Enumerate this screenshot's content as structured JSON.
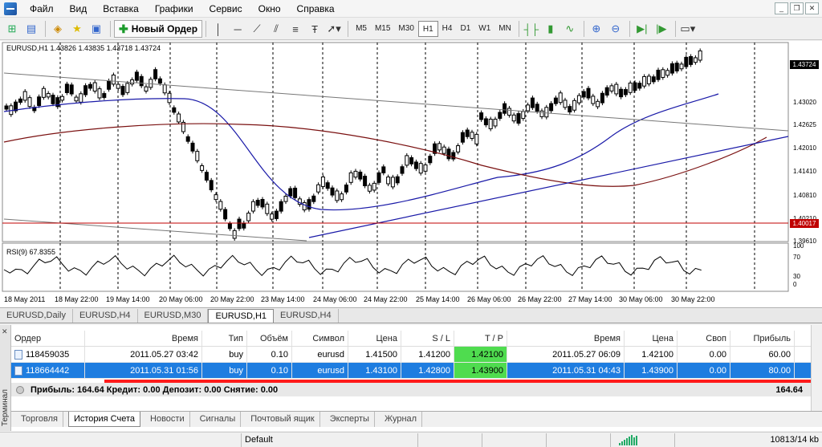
{
  "menu": [
    "Файл",
    "Вид",
    "Вставка",
    "Графики",
    "Сервис",
    "Окно",
    "Справка"
  ],
  "toolbar": {
    "new_order_label": "Новый Ордер",
    "timeframes": [
      "M5",
      "M15",
      "M30",
      "H1",
      "H4",
      "D1",
      "W1",
      "MN"
    ],
    "active_timeframe": "H1"
  },
  "chart": {
    "symbol_info": "EURUSD,H1  1.43826 1.43835 1.43718 1.43724",
    "rsi_info": "RSI(9) 67.8355",
    "current_price": "1.43724",
    "level_price": "1.40017",
    "price_labels": [
      "1.43020",
      "1.42625",
      "1.42010",
      "1.41410",
      "1.40810",
      "1.40210",
      "1.39610"
    ],
    "rsi_labels": [
      "70",
      "30",
      "0"
    ],
    "rsi_top_label": "100",
    "date_labels": [
      "18 May 2011",
      "18 May 22:00",
      "19 May 14:00",
      "20 May 06:00",
      "20 May 22:00",
      "23 May 14:00",
      "24 May 06:00",
      "24 May 22:00",
      "25 May 14:00",
      "26 May 06:00",
      "26 May 22:00",
      "27 May 14:00",
      "30 May 06:00",
      "30 May 22:00"
    ]
  },
  "chart_tabs": [
    "EURUSD,Daily",
    "EURUSD,H4",
    "EURUSD,M30",
    "EURUSD,H1",
    "EURUSD,H4"
  ],
  "active_chart_tab": "EURUSD,H1",
  "terminal": {
    "side_label": "Терминал",
    "headers": [
      "Ордер",
      "Время",
      "Тип",
      "Объём",
      "Символ",
      "Цена",
      "S / L",
      "T / P",
      "Время",
      "Цена",
      "Своп",
      "Прибыль"
    ],
    "rows": [
      [
        "118459035",
        "2011.05.27 03:42",
        "buy",
        "0.10",
        "eurusd",
        "1.41500",
        "1.41200",
        "1.42100",
        "2011.05.27 06:09",
        "1.42100",
        "0.00",
        "60.00"
      ],
      [
        "118664442",
        "2011.05.31 01:56",
        "buy",
        "0.10",
        "eurusd",
        "1.43100",
        "1.42800",
        "1.43900",
        "2011.05.31 04:43",
        "1.43900",
        "0.00",
        "80.00"
      ]
    ],
    "summary_text": "Прибыль: 164.64  Кредит: 0.00  Депозит: 0.00  Снятие: 0.00",
    "summary_total": "164.64",
    "tabs": [
      "Торговля",
      "История Счета",
      "Новости",
      "Сигналы",
      "Почтовый ящик",
      "Эксперты",
      "Журнал"
    ],
    "active_tab": "История Счета"
  },
  "status": {
    "profile": "Default",
    "traffic": "10813/14 kb"
  },
  "colors": {
    "tp_highlight": "#4fdc4f",
    "selection": "#1e7de0",
    "level_line": "#c00000",
    "ma_blue": "#1a1aa8",
    "ma_brown": "#7a1010",
    "annotation_red": "#ff1a1a"
  }
}
